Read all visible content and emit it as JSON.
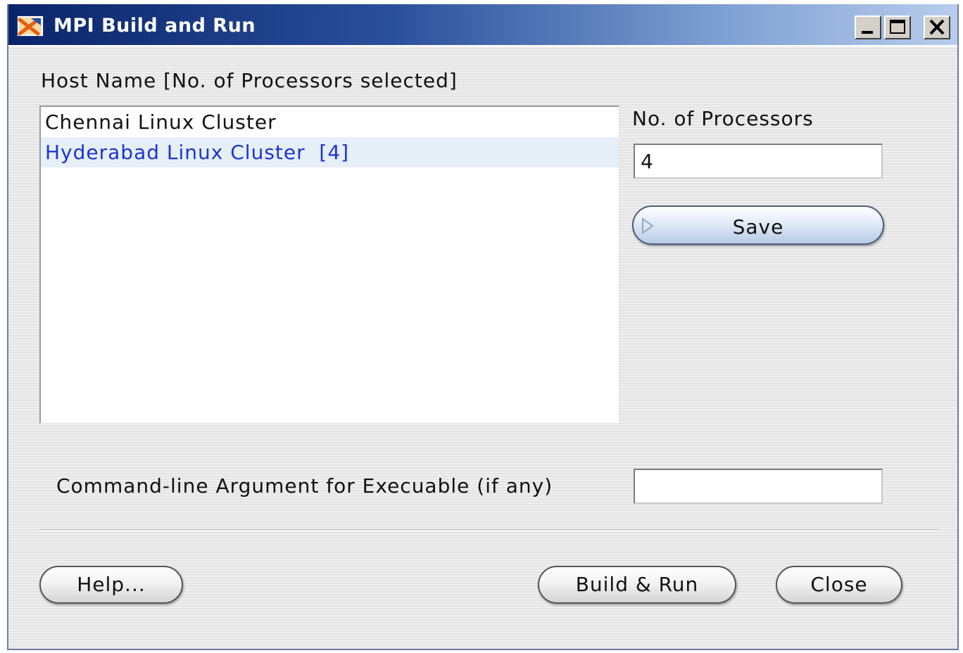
{
  "window": {
    "title": "MPI Build and Run",
    "icon": "mpi-app-icon",
    "controls": [
      "minimize-icon",
      "maximize-icon",
      "close-icon"
    ]
  },
  "hosts": {
    "label": "Host Name [No. of Processors selected]",
    "items": [
      {
        "label": "Chennai Linux Cluster",
        "selected": false
      },
      {
        "label": "Hyderabad Linux Cluster  [4]",
        "selected": true
      }
    ]
  },
  "processors": {
    "label": "No. of Processors",
    "value": "4",
    "save_label": "Save"
  },
  "arguments": {
    "label": "Command-line Argument for Execuable (if any)",
    "value": ""
  },
  "footer": {
    "help_label": "Help...",
    "build_run_label": "Build & Run",
    "close_label": "Close"
  },
  "colors": {
    "title_bar": "#0a246a",
    "selected_text": "#1a35d0",
    "selected_bg": "#e6eef8"
  }
}
